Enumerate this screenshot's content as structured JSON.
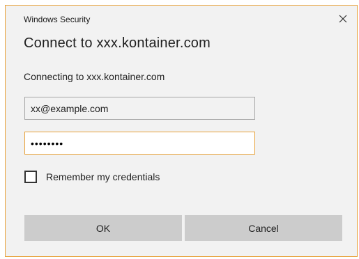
{
  "window": {
    "title": "Windows Security",
    "close_icon": "close-icon"
  },
  "dialog": {
    "heading": "Connect to xxx.kontainer.com",
    "message": "Connecting to xxx.kontainer.com"
  },
  "form": {
    "username_value": "xx@example.com",
    "password_masked": "••••••••",
    "remember_label": "Remember my credentials",
    "remember_checked": false
  },
  "buttons": {
    "ok_label": "OK",
    "cancel_label": "Cancel"
  },
  "colors": {
    "accent_border": "#e8a23a",
    "dialog_background": "#f2f2f2",
    "button_background": "#cccccc"
  }
}
